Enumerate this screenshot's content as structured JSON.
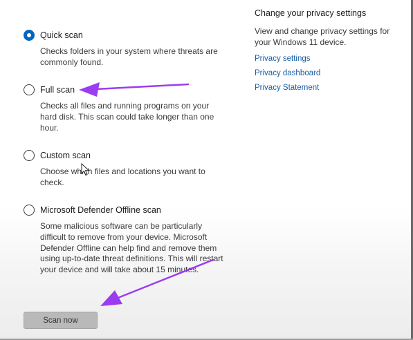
{
  "options": [
    {
      "label": "Quick scan",
      "description": "Checks folders in your system where threats are commonly found.",
      "selected": true
    },
    {
      "label": "Full scan",
      "description": "Checks all files and running programs on your hard disk. This scan could take longer than one hour.",
      "selected": false
    },
    {
      "label": "Custom scan",
      "description": "Choose which files and locations you want to check.",
      "selected": false
    },
    {
      "label": "Microsoft Defender Offline scan",
      "description": "Some malicious software can be particularly difficult to remove from your device. Microsoft Defender Offline can help find and remove them using up-to-date threat definitions. This will restart your device and will take about 15 minutes.",
      "selected": false
    }
  ],
  "scan_button": {
    "label": "Scan now"
  },
  "privacy": {
    "title": "Change your privacy settings",
    "description": "View and change privacy settings for your Windows 11 device.",
    "links": [
      "Privacy settings",
      "Privacy dashboard",
      "Privacy Statement"
    ]
  },
  "annotations": {
    "arrow_color": "#9b3cf0",
    "accent_color": "#0067c0",
    "link_color": "#1a5fa8"
  }
}
